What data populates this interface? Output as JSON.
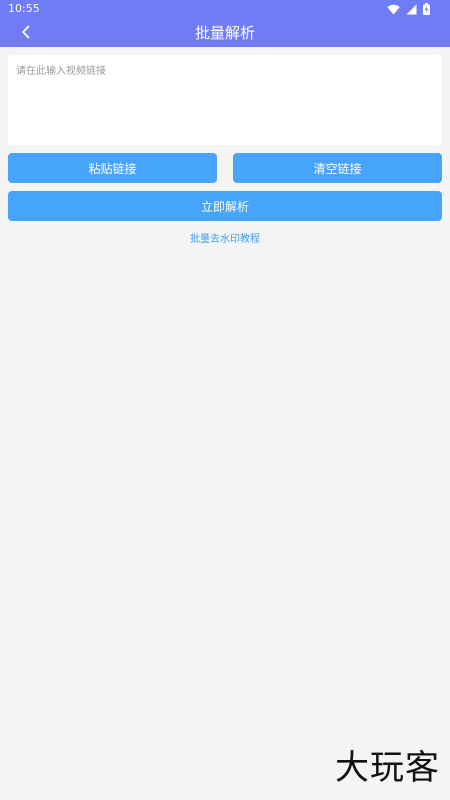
{
  "status_bar": {
    "time": "10:55",
    "icons": [
      "wifi-icon",
      "signal-icon",
      "battery-icon"
    ]
  },
  "header": {
    "title": "批量解析",
    "back_icon": "chevron-left-icon"
  },
  "input": {
    "placeholder": "请在此输入视频链接",
    "value": ""
  },
  "buttons": {
    "paste_label": "粘贴链接",
    "clear_label": "清空链接",
    "parse_label": "立即解析"
  },
  "tutorial_link": "批量去水印教程",
  "watermark": "大玩客",
  "colors": {
    "header_bg": "#6f7cf4",
    "button_bg": "#46a5fb",
    "link": "#3c9ef0",
    "page_bg": "#f4f4f5"
  }
}
